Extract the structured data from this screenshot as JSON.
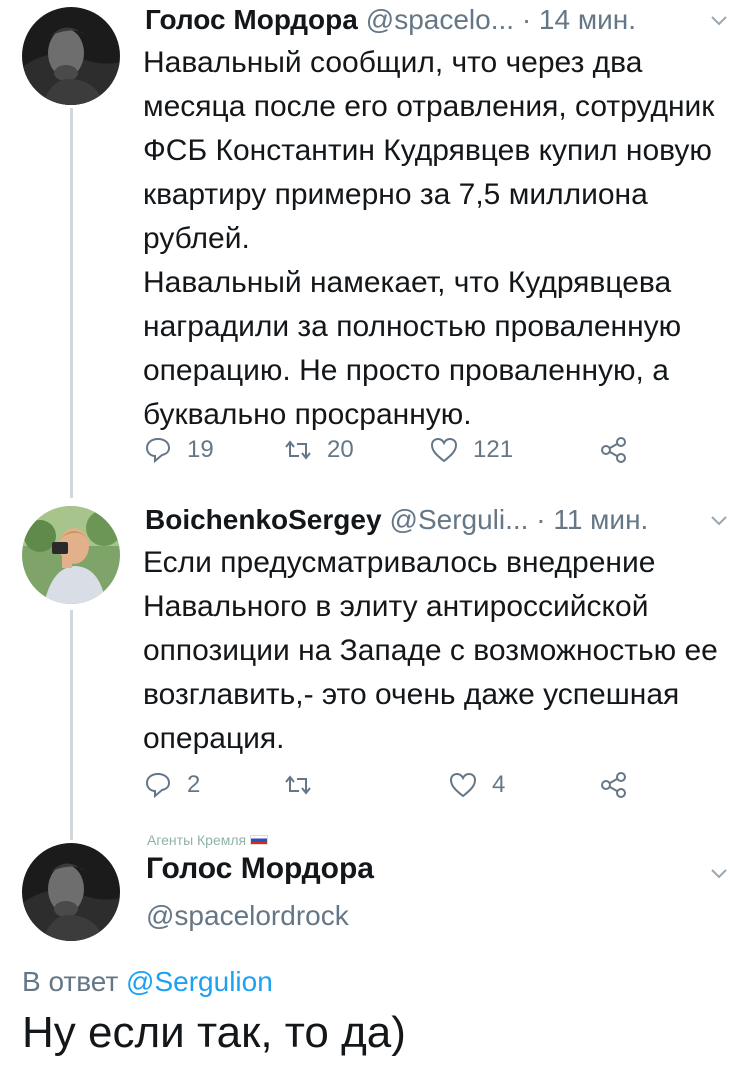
{
  "tweets": [
    {
      "name": "Голос Мордора",
      "meta": "@spacelo... · 14 мин.",
      "text": "Навальный сообщил, что через два месяца после его отравления, сотрудник ФСБ Константин Кудрявцев купил новую квартиру примерно за 7,5 миллиона рублей.\nНавальный намекает, что Кудрявцева наградили за полностью проваленную операцию. Не просто проваленную, а буквально просранную.",
      "replies": "19",
      "retweets": "20",
      "likes": "121"
    },
    {
      "name": "BoichenkoSergey",
      "meta": "@Serguli... · 11 мин.",
      "text": "Если предусматривалось внедрение Навального в элиту антироссийской оппозиции на Западе с возможностью ее возглавить,- это очень даже успешная операция.",
      "replies": "2",
      "retweets": "",
      "likes": "4"
    }
  ],
  "focused": {
    "badge": "Агенты Кремля",
    "name": "Голос Мордора",
    "handle": "@spacelordrock",
    "reply_prefix": "В ответ",
    "reply_handle": "@Sergulion",
    "text": "Ну если так, то да)"
  },
  "icons": [
    "reply-icon",
    "retweet-icon",
    "like-icon",
    "share-icon",
    "chevron-down-icon",
    "flag-icon"
  ],
  "colors": {
    "text": "#14171a",
    "secondary": "#657786",
    "link": "#1da1f2",
    "thread_line": "#d2d7db"
  }
}
